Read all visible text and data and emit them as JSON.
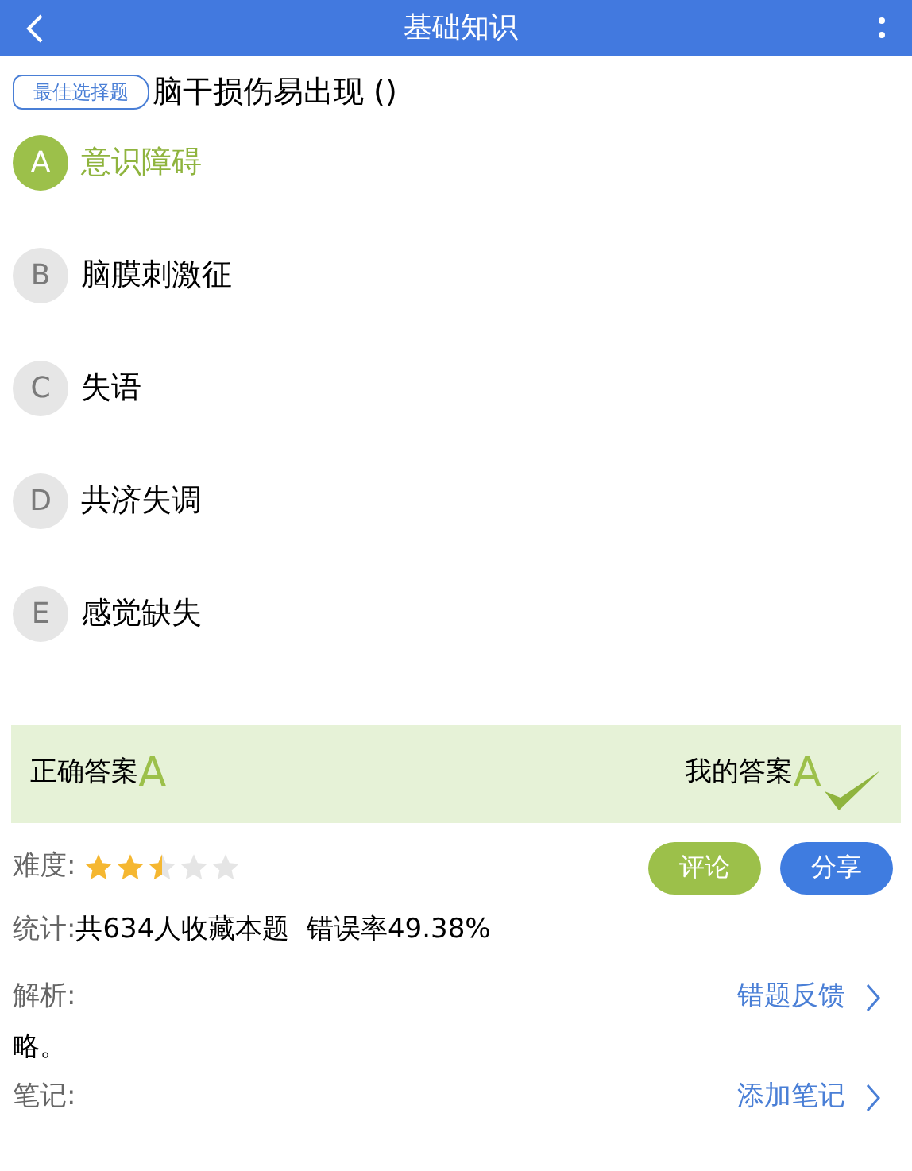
{
  "header": {
    "title": "基础知识"
  },
  "question": {
    "tag": "最佳选择题",
    "text": "脑干损伤易出现 ()"
  },
  "options": [
    {
      "letter": "A",
      "text": "意识障碍",
      "selected": true
    },
    {
      "letter": "B",
      "text": "脑膜刺激征",
      "selected": false
    },
    {
      "letter": "C",
      "text": "失语",
      "selected": false
    },
    {
      "letter": "D",
      "text": "共济失调",
      "selected": false
    },
    {
      "letter": "E",
      "text": "感觉缺失",
      "selected": false
    }
  ],
  "answer": {
    "correct_label": "正确答案",
    "correct": "A",
    "mine_label": "我的答案",
    "mine": "A",
    "is_correct": true
  },
  "difficulty": {
    "label": "难度:",
    "stars": 2.5
  },
  "buttons": [
    {
      "kind": "comment",
      "label": "评论"
    },
    {
      "kind": "share",
      "label": "分享"
    }
  ],
  "stats": {
    "label": "统计:",
    "text": "共634人收藏本题  错误率49.38%"
  },
  "analysis": {
    "label": "解析:",
    "link": "错题反馈",
    "text": "略。"
  },
  "notes": {
    "label": "笔记:",
    "link": "添加笔记"
  }
}
